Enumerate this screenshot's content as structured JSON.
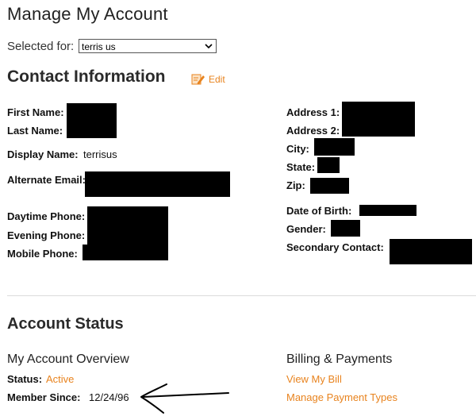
{
  "page": {
    "title": "Manage My Account"
  },
  "selector": {
    "label": "Selected for:",
    "value": "terris us"
  },
  "contact": {
    "heading": "Contact Information",
    "edit_label": "Edit",
    "left": {
      "first_name": "First Name:",
      "last_name": "Last Name:",
      "display_name": "Display Name:",
      "display_name_value": "terrisus",
      "alternate_email": "Alternate Email:",
      "daytime_phone": "Daytime Phone:",
      "evening_phone": "Evening Phone:",
      "mobile_phone": "Mobile Phone:"
    },
    "right": {
      "address1": "Address 1:",
      "address2": "Address 2:",
      "city": "City:",
      "state": "State:",
      "zip": "Zip:",
      "dob": "Date of Birth:",
      "gender": "Gender:",
      "secondary_contact": "Secondary Contact:"
    }
  },
  "account_status": {
    "heading": "Account Status",
    "overview": {
      "title": "My Account Overview",
      "status_label": "Status:",
      "status_value": "Active",
      "member_since_label": "Member Since:",
      "member_since_value": "12/24/96"
    },
    "billing": {
      "title": "Billing & Payments",
      "view_bill": "View My Bill",
      "manage_payment": "Manage Payment Types"
    }
  },
  "colors": {
    "accent": "#e8831e",
    "redaction": "#000000"
  },
  "icons": {
    "edit": "pencil-note-icon",
    "dropdown": "chevron-down-icon",
    "annotation": "hand-drawn-arrow"
  }
}
